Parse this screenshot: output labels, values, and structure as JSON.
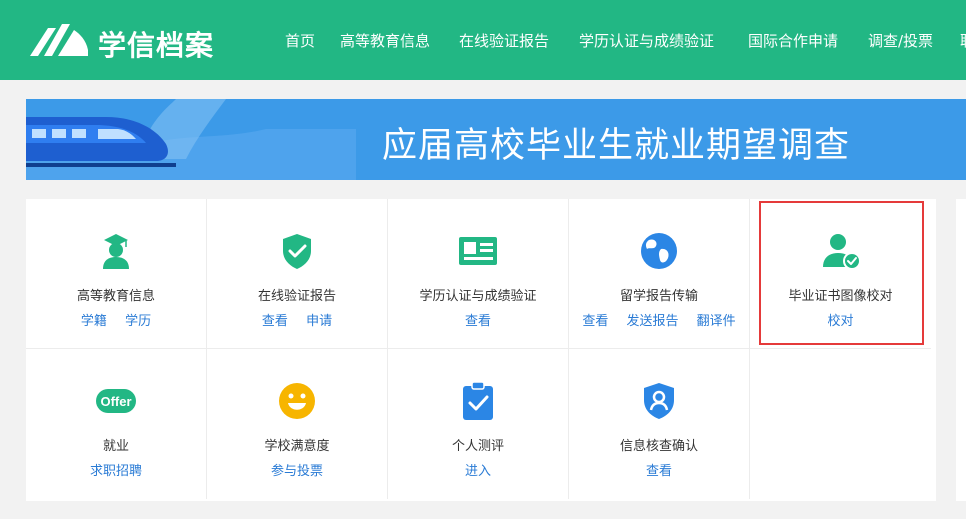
{
  "header": {
    "brand": "学信档案",
    "nav": [
      "首页",
      "高等教育信息",
      "在线验证报告",
      "学历认证与成绩验证",
      "国际合作申请",
      "调查/投票",
      "职"
    ]
  },
  "banner": {
    "title": "应届高校毕业生就业期望调查"
  },
  "services": [
    {
      "title": "高等教育信息",
      "links": [
        "学籍",
        "学历"
      ],
      "icon": "graduate-icon"
    },
    {
      "title": "在线验证报告",
      "links": [
        "查看",
        "申请"
      ],
      "icon": "shield-check-icon"
    },
    {
      "title": "学历认证与成绩验证",
      "links": [
        "查看"
      ],
      "icon": "certificate-card-icon"
    },
    {
      "title": "留学报告传输",
      "links": [
        "查看",
        "发送报告",
        "翻译件"
      ],
      "icon": "globe-icon"
    },
    {
      "title": "毕业证书图像校对",
      "links": [
        "校对"
      ],
      "icon": "user-verified-icon"
    },
    {
      "title": "就业",
      "links": [
        "求职招聘"
      ],
      "icon": "offer-icon",
      "icon_text": "Offer"
    },
    {
      "title": "学校满意度",
      "links": [
        "参与投票"
      ],
      "icon": "smiley-icon"
    },
    {
      "title": "个人测评",
      "links": [
        "进入"
      ],
      "icon": "clipboard-check-icon"
    },
    {
      "title": "信息核查确认",
      "links": [
        "查看"
      ],
      "icon": "user-shield-icon"
    }
  ],
  "colors": {
    "green": "#22b784",
    "blue": "#2b86e5",
    "link": "#2a7bd5",
    "highlight": "#e53a3a",
    "yellow": "#f7b500"
  }
}
